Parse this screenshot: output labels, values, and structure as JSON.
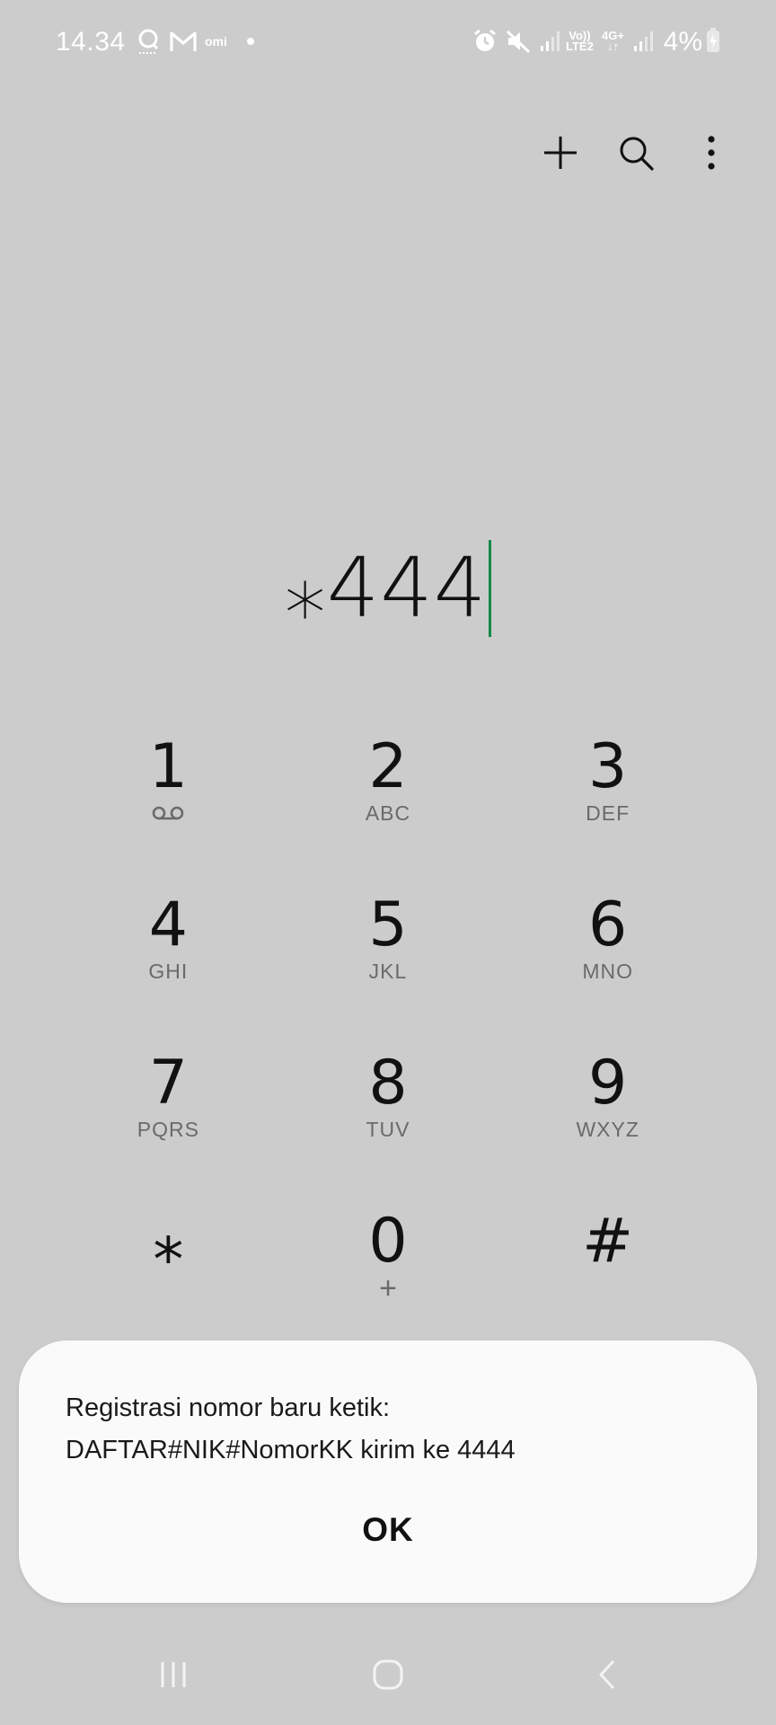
{
  "status_bar": {
    "time": "14.34",
    "lte_label_top": "Vo))",
    "lte_label_bottom": "LTE2",
    "net_label": "4G+",
    "battery": "4%",
    "icons": [
      "notification-app-icon",
      "gmail-icon",
      "omi-icon",
      "dot-icon",
      "alarm-icon",
      "mute-icon",
      "signal-icon",
      "volte-icon",
      "4g-data-icon",
      "signal-icon",
      "battery-charging-icon"
    ]
  },
  "toolbar": {
    "icons": [
      "add-icon",
      "search-icon",
      "more-options-icon"
    ]
  },
  "dialer": {
    "number": "⁎444",
    "accent_color": "#168a4a"
  },
  "keypad": {
    "keys": [
      {
        "digit": "1",
        "sub": ""
      },
      {
        "digit": "2",
        "sub": "ABC"
      },
      {
        "digit": "3",
        "sub": "DEF"
      },
      {
        "digit": "4",
        "sub": "GHI"
      },
      {
        "digit": "5",
        "sub": "JKL"
      },
      {
        "digit": "6",
        "sub": "MNO"
      },
      {
        "digit": "7",
        "sub": "PQRS"
      },
      {
        "digit": "8",
        "sub": "TUV"
      },
      {
        "digit": "9",
        "sub": "WXYZ"
      },
      {
        "digit": "⁎",
        "sub": ""
      },
      {
        "digit": "0",
        "sub": "+"
      },
      {
        "digit": "#",
        "sub": ""
      }
    ]
  },
  "dialog": {
    "line1": "Registrasi nomor baru ketik:",
    "line2": "DAFTAR#NIK#NomorKK kirim ke 4444",
    "ok_label": "OK"
  },
  "navbar": {
    "icons": [
      "recent-apps-icon",
      "home-icon",
      "back-icon"
    ]
  }
}
